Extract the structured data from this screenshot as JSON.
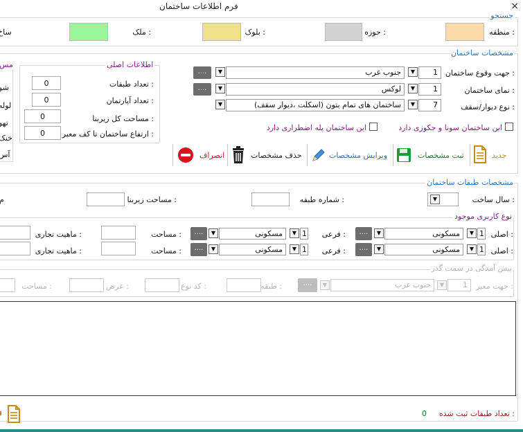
{
  "window": {
    "title": "فرم اطلاعات ساختمان",
    "close_label": "×"
  },
  "search": {
    "title": "جستجو",
    "fields": [
      {
        "label": "منطقه :",
        "color": "#fcd9a8"
      },
      {
        "label": "حوزه :",
        "color": "#d3d3d3"
      },
      {
        "label": "بلوک :",
        "color": "#efe08a"
      },
      {
        "label": "ملک :",
        "color": "#98f598"
      },
      {
        "label": "ساخ"
      }
    ]
  },
  "building": {
    "title": "مشخصات ساختمان",
    "rows": [
      {
        "label": "جهت وقوع ساختمان :",
        "code": "1",
        "value": "جنوب غرب",
        "has_dots": true
      },
      {
        "label": "نمای ساختمان :",
        "code": "1",
        "value": "لوکس",
        "has_dots": true
      },
      {
        "label": "نوع دیوار/سقف :",
        "code": "7",
        "value": "ساختمان های تمام بتون (اسکلت ،دیوار سقف)",
        "has_dots": false
      }
    ],
    "dots_label": "....",
    "sauna_label": "این ساختمان سونا و جکوزی دارد",
    "emergency_label": "این ساختمان پله اضطراری دارد"
  },
  "main_info": {
    "title": "اطلاعات اصلی",
    "fields": [
      {
        "label": "تعداد طبقات :",
        "value": "0"
      },
      {
        "label": "تعداد آپارتمان :",
        "value": "0"
      },
      {
        "label": "مساحت کل زیربنا :",
        "value": "0"
      },
      {
        "label": "ارتفاع ساختمان تا کف معبر :",
        "value": "0"
      }
    ]
  },
  "side_panel": {
    "title": "مس",
    "items": [
      "شو",
      "لوله",
      "تهو",
      "خنک",
      "آس"
    ]
  },
  "toolbar": {
    "new_label": "جدید",
    "save_label": "ثبت مشخصات",
    "edit_label": "ویرایش مشخصات",
    "delete_label": "حذف مشخصات",
    "cancel_label": "انصراف"
  },
  "floors": {
    "title": "مشخصات طبقات ساختمان",
    "build_year_label": "سال ساخت :",
    "floor_number_label": "شماره طبقه :",
    "floor_area_label": "مساحت زیربنا :",
    "cut_label": "م"
  },
  "usage": {
    "title": "نوع کاربری موجود",
    "rows": [
      {
        "main_label": "اصلی :",
        "main_code": "1",
        "main_value": "مسکونی",
        "sub_label": "فرعی :",
        "sub_code": "1",
        "sub_value": "مسکونی",
        "area_label": "مساحت :",
        "trade_label": "ماهیت تجاری :"
      },
      {
        "main_label": "اصلی :",
        "main_code": "1",
        "main_value": "مسکونی",
        "sub_label": "فرعی :",
        "sub_code": "1",
        "sub_value": "مسکونی",
        "area_label": "مساحت :",
        "trade_label": "ماهیت تجاری :"
      }
    ],
    "dots_label": "...."
  },
  "setback": {
    "title": "پیش آمدگی در سمت گذر",
    "direction_label": "جهت معبر :",
    "direction_code": "1",
    "direction_value": "جنوب غرب",
    "floor_label": "طبقه :",
    "type_code_label": "کد نوع :",
    "width_label": "عرض :",
    "area_label": "مساحت :",
    "dots_label": "...."
  },
  "footer": {
    "count_label": "تعداد طبقات ثبت شده :",
    "count_value": "0"
  },
  "colors": {
    "accent": "#2a73c2",
    "purple": "#8b1a8b",
    "save_green": "#1a9c3a",
    "cancel_red": "#d9141c",
    "new_gold": "#c88a10"
  }
}
